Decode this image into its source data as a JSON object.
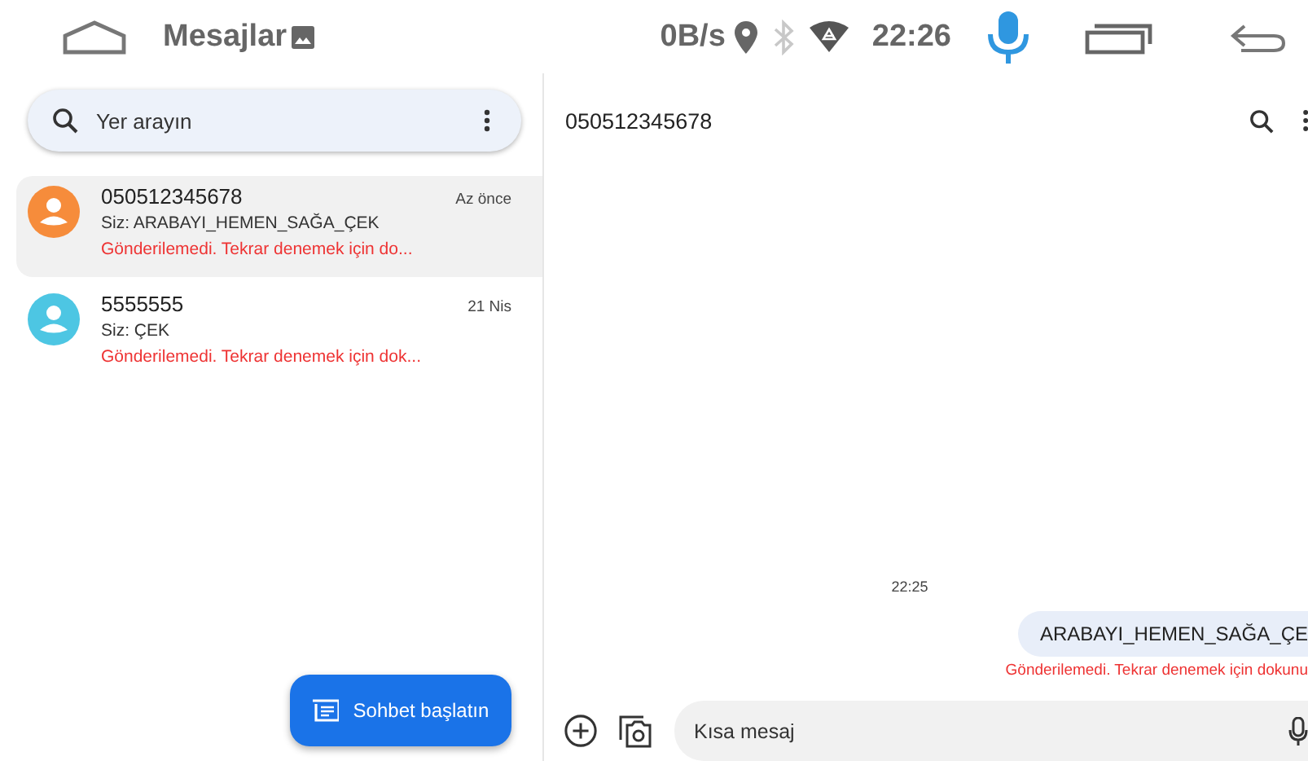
{
  "status_bar": {
    "app_title": "Mesajlar",
    "net_speed": "0B/s",
    "bluetooth_on": false,
    "time": "22:26"
  },
  "search": {
    "placeholder": "Yer arayın"
  },
  "conversations": [
    {
      "name": "050512345678",
      "time": "Az önce",
      "snippet": "Siz: ARABAYI_HEMEN_SAĞA_ÇEK",
      "status": "Gönderilemedi. Tekrar denemek için do...",
      "color": "#f68c3b",
      "selected": true
    },
    {
      "name": "5555555",
      "time": "21 Nis",
      "snippet": "Siz: ÇEK",
      "status": "Gönderilemedi. Tekrar denemek için dok...",
      "color": "#4dc6e3",
      "selected": false
    }
  ],
  "fab": {
    "label": "Sohbet başlatın"
  },
  "chat": {
    "title": "050512345678",
    "timestamp": "22:25",
    "message": "ARABAYI_HEMEN_SAĞA_ÇE",
    "message_status": "Gönderilemedi. Tekrar denemek için dokunu",
    "input": {
      "placeholder": "Kısa mesaj"
    }
  }
}
